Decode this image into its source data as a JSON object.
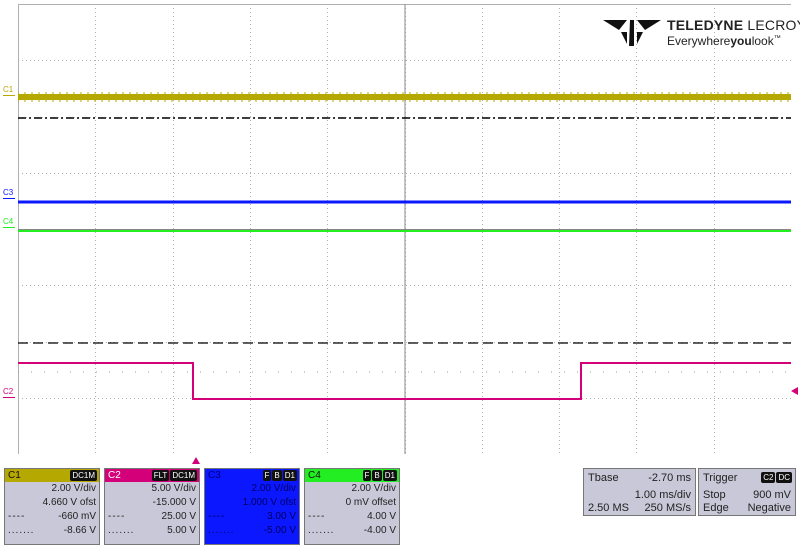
{
  "brand": {
    "name_bold": "TELEDYNE",
    "name_thin": "LECROY",
    "tagline_pre": "Everywhere",
    "tagline_bold": "you",
    "tagline_post": "look",
    "tm": "™"
  },
  "channels": [
    {
      "id": "c1",
      "label": "C1",
      "color": "#b5a800",
      "tags": [
        "DC1M"
      ],
      "vdiv": "2.00 V/div",
      "offset": "4.660 V ofst",
      "line1_label": "----",
      "line1_value": "-660 mV",
      "line2_label": ".......",
      "line2_value": "-8.66 V"
    },
    {
      "id": "c2",
      "label": "C2",
      "color": "#d4007a",
      "tags": [
        "FLT",
        "DC1M"
      ],
      "vdiv": "5.00 V/div",
      "offset": "-15.000 V",
      "line1_label": "----",
      "line1_value": "25.00 V",
      "line2_label": ".......",
      "line2_value": "5.00 V"
    },
    {
      "id": "c3",
      "label": "C3",
      "color": "#0a17ff",
      "tags": [
        "F",
        "B",
        "D1"
      ],
      "vdiv": "2.00 V/div",
      "offset": "1.000 V ofst",
      "line1_label": "----",
      "line1_value": "3.00 V",
      "line2_label": ".......",
      "line2_value": "-5.00 V"
    },
    {
      "id": "c4",
      "label": "C4",
      "color": "#22ee22",
      "tags": [
        "F",
        "B",
        "D1"
      ],
      "vdiv": "2.00 V/div",
      "offset": "0 mV offset",
      "line1_label": "----",
      "line1_value": "4.00 V",
      "line2_label": ".......",
      "line2_value": "-4.00 V"
    }
  ],
  "timebase": {
    "title": "Tbase",
    "delay": "-2.70 ms",
    "tdiv": "1.00 ms/div",
    "samples": "2.50 MS",
    "rate": "250 MS/s"
  },
  "trigger": {
    "title": "Trigger",
    "tags": [
      "C2",
      "DC"
    ],
    "mode": "Stop",
    "level": "900 mV",
    "type": "Edge",
    "slope": "Negative"
  },
  "colors": {
    "grid": "#b0b0b0",
    "cursor": "#000000",
    "c1": "#b5a800",
    "c2": "#d4007a",
    "c3": "#0a17ff",
    "c4": "#22ee22"
  }
}
